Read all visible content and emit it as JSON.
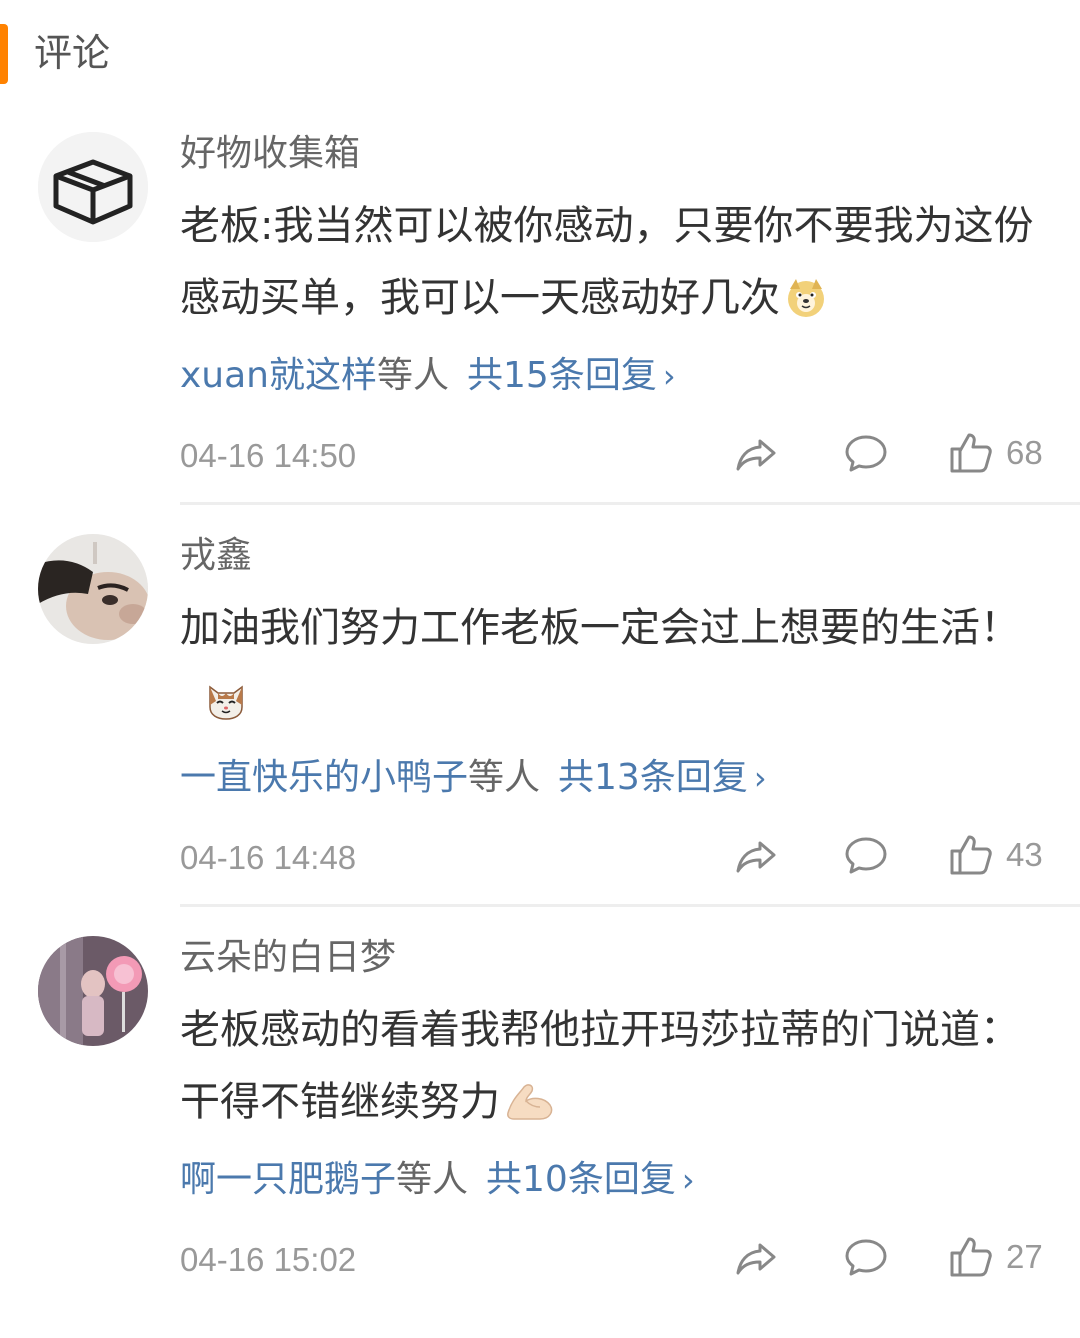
{
  "section": {
    "title": "评论"
  },
  "comments": [
    {
      "username": "好物收集箱",
      "avatar_icon": "box-icon",
      "text": "老板:我当然可以被你感动，只要你不要我为这份感动买单，我可以一天感动好几次",
      "emoji": "doge-emoji",
      "reply_users": "xuan就这样",
      "reply_mid": "等人",
      "reply_count": "共15条回复",
      "time": "04-16 14:50",
      "likes": "68"
    },
    {
      "username": "戎鑫",
      "avatar_icon": "profile-photo",
      "text": "加油我们努力工作老板一定会过上想要的生活！",
      "emoji": "cat-emoji",
      "reply_users": "一直快乐的小鸭子",
      "reply_mid": "等人",
      "reply_count": "共13条回复",
      "time": "04-16 14:48",
      "likes": "43"
    },
    {
      "username": "云朵的白日梦",
      "avatar_icon": "profile-photo",
      "text": "老板感动的看着我帮他拉开玛莎拉蒂的门说道：干得不错继续努力",
      "emoji": "flexed-biceps-emoji",
      "reply_users": "啊一只肥鹅子",
      "reply_mid": "等人",
      "reply_count": "共10条回复",
      "time": "04-16 15:02",
      "likes": "27"
    }
  ],
  "icons": {
    "share": "share-icon",
    "comment": "comment-icon",
    "like": "thumbs-up-icon"
  },
  "colors": {
    "accent": "#ff8200",
    "link": "#4b79ad",
    "meta": "#999999"
  }
}
